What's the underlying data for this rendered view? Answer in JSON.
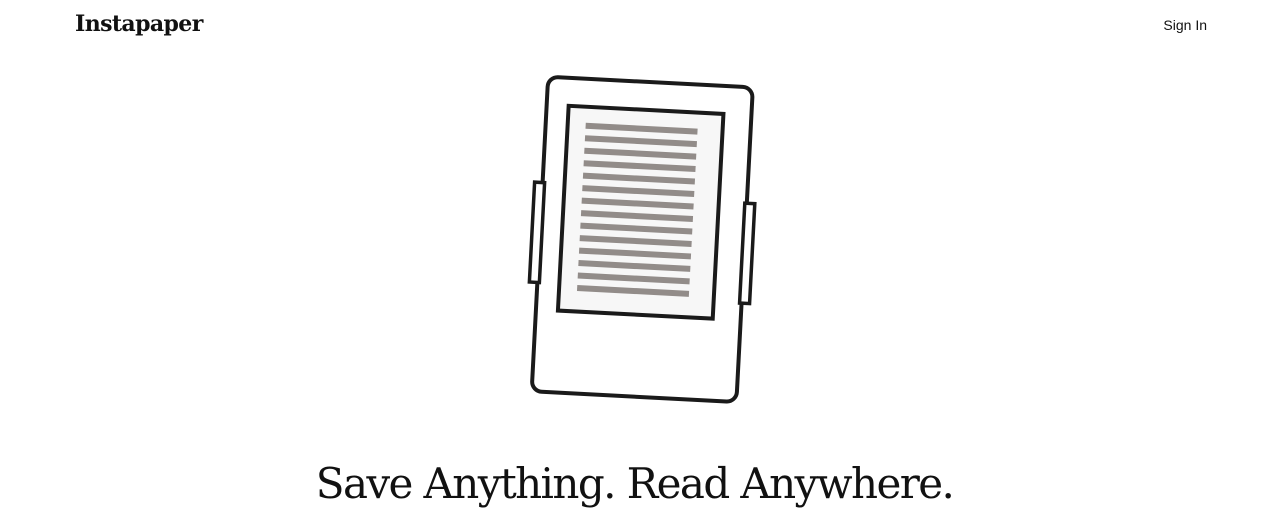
{
  "header": {
    "logo_text": "Instapaper",
    "sign_in_label": "Sign In"
  },
  "hero": {
    "illustration_icon": "e-reader-icon",
    "headline": "Save Anything. Read Anywhere."
  },
  "colors": {
    "text": "#111111",
    "device_outline": "#1a1a1a",
    "text_lines": "#928c89",
    "background": "#ffffff"
  }
}
